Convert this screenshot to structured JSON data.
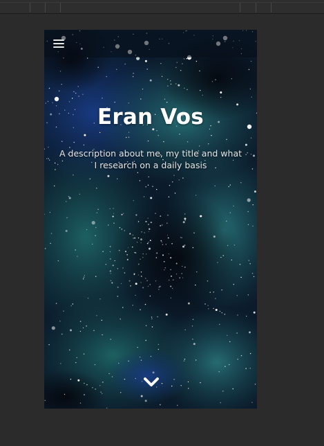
{
  "hero": {
    "title": "Eran Vos",
    "description": "A description about me, my title and what I research on a daily basis"
  },
  "icons": {
    "menu": "hamburger-menu-icon",
    "scroll": "chevron-down-icon"
  },
  "colors": {
    "editor_background": "#2b2b2b",
    "sky_deep": "#0a1a2a",
    "sky_teal": "#1d5a62",
    "sky_blue": "#12306b",
    "text": "#ffffff"
  }
}
